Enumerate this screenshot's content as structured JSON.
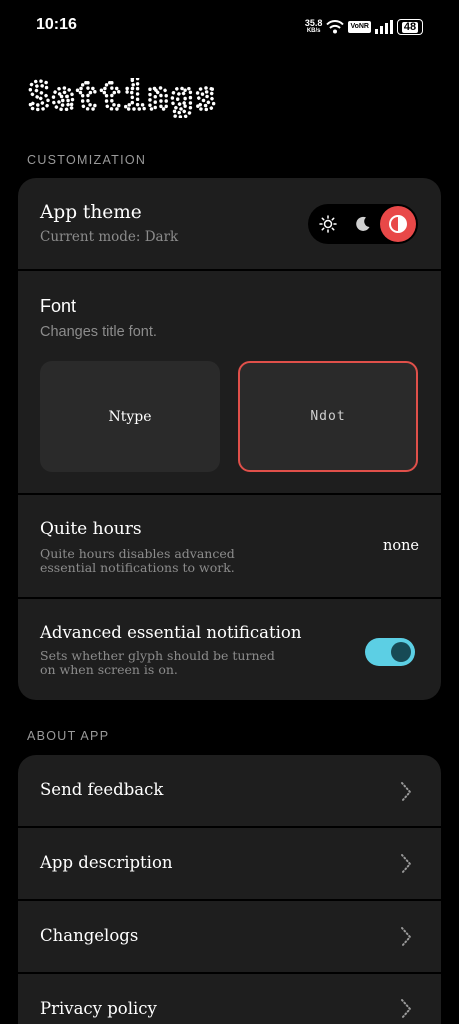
{
  "status_bar": {
    "time": "10:16",
    "net_speed_value": "35.8",
    "net_speed_unit": "KB/s",
    "network_badge": "VoNR",
    "battery": "48",
    "icons": [
      "wifi-icon",
      "signal-icon",
      "battery-icon"
    ]
  },
  "page": {
    "title": "Settings"
  },
  "customization": {
    "section_label": "CUSTOMIZATION",
    "app_theme": {
      "title": "App theme",
      "subtitle": "Current mode: Dark",
      "options": [
        "light",
        "dark",
        "system"
      ],
      "selected": "system"
    },
    "font": {
      "title": "Font",
      "subtitle": "Changes title font.",
      "options": [
        "Ntype",
        "Ndot"
      ],
      "selected": "Ndot"
    },
    "quiet_hours": {
      "title": "Quite hours",
      "subtitle_line1": "Quite hours disables advanced",
      "subtitle_line2": "essential notifications to work.",
      "value": "none"
    },
    "advanced_notification": {
      "title": "Advanced essential notification",
      "subtitle_line1": "Sets whether glyph should be turned",
      "subtitle_line2": "on when screen is on.",
      "enabled": true
    }
  },
  "about": {
    "section_label": "ABOUT APP",
    "items": [
      {
        "label": "Send feedback"
      },
      {
        "label": "App description"
      },
      {
        "label": "Changelogs"
      },
      {
        "label": "Privacy policy"
      }
    ]
  },
  "colors": {
    "background": "#000000",
    "card": "#1e1e1e",
    "accent_red": "#e84848",
    "toggle_on": "#5ccfe4"
  }
}
